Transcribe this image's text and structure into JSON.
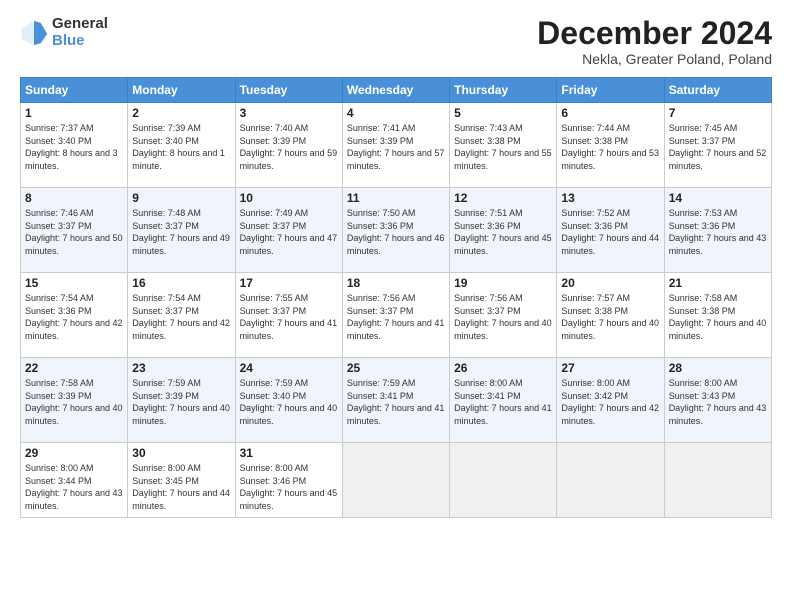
{
  "logo": {
    "general": "General",
    "blue": "Blue"
  },
  "title": "December 2024",
  "subtitle": "Nekla, Greater Poland, Poland",
  "days_header": [
    "Sunday",
    "Monday",
    "Tuesday",
    "Wednesday",
    "Thursday",
    "Friday",
    "Saturday"
  ],
  "weeks": [
    [
      {
        "day": "1",
        "sunrise": "Sunrise: 7:37 AM",
        "sunset": "Sunset: 3:40 PM",
        "daylight": "Daylight: 8 hours and 3 minutes."
      },
      {
        "day": "2",
        "sunrise": "Sunrise: 7:39 AM",
        "sunset": "Sunset: 3:40 PM",
        "daylight": "Daylight: 8 hours and 1 minute."
      },
      {
        "day": "3",
        "sunrise": "Sunrise: 7:40 AM",
        "sunset": "Sunset: 3:39 PM",
        "daylight": "Daylight: 7 hours and 59 minutes."
      },
      {
        "day": "4",
        "sunrise": "Sunrise: 7:41 AM",
        "sunset": "Sunset: 3:39 PM",
        "daylight": "Daylight: 7 hours and 57 minutes."
      },
      {
        "day": "5",
        "sunrise": "Sunrise: 7:43 AM",
        "sunset": "Sunset: 3:38 PM",
        "daylight": "Daylight: 7 hours and 55 minutes."
      },
      {
        "day": "6",
        "sunrise": "Sunrise: 7:44 AM",
        "sunset": "Sunset: 3:38 PM",
        "daylight": "Daylight: 7 hours and 53 minutes."
      },
      {
        "day": "7",
        "sunrise": "Sunrise: 7:45 AM",
        "sunset": "Sunset: 3:37 PM",
        "daylight": "Daylight: 7 hours and 52 minutes."
      }
    ],
    [
      {
        "day": "8",
        "sunrise": "Sunrise: 7:46 AM",
        "sunset": "Sunset: 3:37 PM",
        "daylight": "Daylight: 7 hours and 50 minutes."
      },
      {
        "day": "9",
        "sunrise": "Sunrise: 7:48 AM",
        "sunset": "Sunset: 3:37 PM",
        "daylight": "Daylight: 7 hours and 49 minutes."
      },
      {
        "day": "10",
        "sunrise": "Sunrise: 7:49 AM",
        "sunset": "Sunset: 3:37 PM",
        "daylight": "Daylight: 7 hours and 47 minutes."
      },
      {
        "day": "11",
        "sunrise": "Sunrise: 7:50 AM",
        "sunset": "Sunset: 3:36 PM",
        "daylight": "Daylight: 7 hours and 46 minutes."
      },
      {
        "day": "12",
        "sunrise": "Sunrise: 7:51 AM",
        "sunset": "Sunset: 3:36 PM",
        "daylight": "Daylight: 7 hours and 45 minutes."
      },
      {
        "day": "13",
        "sunrise": "Sunrise: 7:52 AM",
        "sunset": "Sunset: 3:36 PM",
        "daylight": "Daylight: 7 hours and 44 minutes."
      },
      {
        "day": "14",
        "sunrise": "Sunrise: 7:53 AM",
        "sunset": "Sunset: 3:36 PM",
        "daylight": "Daylight: 7 hours and 43 minutes."
      }
    ],
    [
      {
        "day": "15",
        "sunrise": "Sunrise: 7:54 AM",
        "sunset": "Sunset: 3:36 PM",
        "daylight": "Daylight: 7 hours and 42 minutes."
      },
      {
        "day": "16",
        "sunrise": "Sunrise: 7:54 AM",
        "sunset": "Sunset: 3:37 PM",
        "daylight": "Daylight: 7 hours and 42 minutes."
      },
      {
        "day": "17",
        "sunrise": "Sunrise: 7:55 AM",
        "sunset": "Sunset: 3:37 PM",
        "daylight": "Daylight: 7 hours and 41 minutes."
      },
      {
        "day": "18",
        "sunrise": "Sunrise: 7:56 AM",
        "sunset": "Sunset: 3:37 PM",
        "daylight": "Daylight: 7 hours and 41 minutes."
      },
      {
        "day": "19",
        "sunrise": "Sunrise: 7:56 AM",
        "sunset": "Sunset: 3:37 PM",
        "daylight": "Daylight: 7 hours and 40 minutes."
      },
      {
        "day": "20",
        "sunrise": "Sunrise: 7:57 AM",
        "sunset": "Sunset: 3:38 PM",
        "daylight": "Daylight: 7 hours and 40 minutes."
      },
      {
        "day": "21",
        "sunrise": "Sunrise: 7:58 AM",
        "sunset": "Sunset: 3:38 PM",
        "daylight": "Daylight: 7 hours and 40 minutes."
      }
    ],
    [
      {
        "day": "22",
        "sunrise": "Sunrise: 7:58 AM",
        "sunset": "Sunset: 3:39 PM",
        "daylight": "Daylight: 7 hours and 40 minutes."
      },
      {
        "day": "23",
        "sunrise": "Sunrise: 7:59 AM",
        "sunset": "Sunset: 3:39 PM",
        "daylight": "Daylight: 7 hours and 40 minutes."
      },
      {
        "day": "24",
        "sunrise": "Sunrise: 7:59 AM",
        "sunset": "Sunset: 3:40 PM",
        "daylight": "Daylight: 7 hours and 40 minutes."
      },
      {
        "day": "25",
        "sunrise": "Sunrise: 7:59 AM",
        "sunset": "Sunset: 3:41 PM",
        "daylight": "Daylight: 7 hours and 41 minutes."
      },
      {
        "day": "26",
        "sunrise": "Sunrise: 8:00 AM",
        "sunset": "Sunset: 3:41 PM",
        "daylight": "Daylight: 7 hours and 41 minutes."
      },
      {
        "day": "27",
        "sunrise": "Sunrise: 8:00 AM",
        "sunset": "Sunset: 3:42 PM",
        "daylight": "Daylight: 7 hours and 42 minutes."
      },
      {
        "day": "28",
        "sunrise": "Sunrise: 8:00 AM",
        "sunset": "Sunset: 3:43 PM",
        "daylight": "Daylight: 7 hours and 43 minutes."
      }
    ],
    [
      {
        "day": "29",
        "sunrise": "Sunrise: 8:00 AM",
        "sunset": "Sunset: 3:44 PM",
        "daylight": "Daylight: 7 hours and 43 minutes."
      },
      {
        "day": "30",
        "sunrise": "Sunrise: 8:00 AM",
        "sunset": "Sunset: 3:45 PM",
        "daylight": "Daylight: 7 hours and 44 minutes."
      },
      {
        "day": "31",
        "sunrise": "Sunrise: 8:00 AM",
        "sunset": "Sunset: 3:46 PM",
        "daylight": "Daylight: 7 hours and 45 minutes."
      },
      null,
      null,
      null,
      null
    ]
  ]
}
